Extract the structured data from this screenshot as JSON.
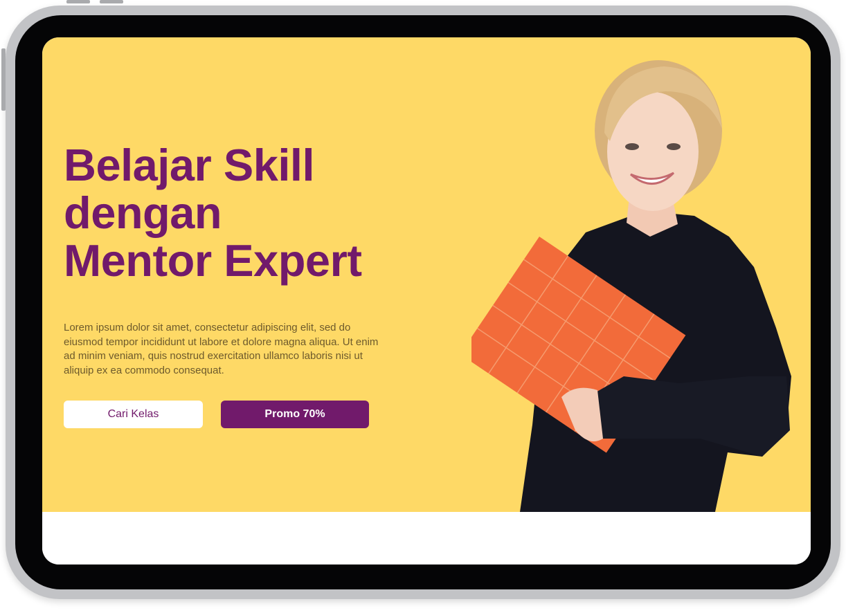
{
  "hero": {
    "headline_line1": "Belajar Skill",
    "headline_line2": "dengan",
    "headline_line3": "Mentor Expert",
    "lead": "Lorem ipsum dolor sit amet, consectetur adipiscing elit, sed do eiusmod tempor incididunt ut labore et dolore magna aliqua. Ut enim ad minim veniam, quis nostrud exercitation ullamco laboris nisi ut aliquip ex ea commodo consequat.",
    "buttons": {
      "search_label": "Cari Kelas",
      "promo_label": "Promo 70%"
    }
  },
  "colors": {
    "hero_background": "#fed966",
    "brand_purple": "#711a6b",
    "bezel": "#050506",
    "folder_orange": "#f26b3a",
    "sweater": "#14151f"
  },
  "icons": {
    "photo": "student-holding-folder-photo"
  }
}
